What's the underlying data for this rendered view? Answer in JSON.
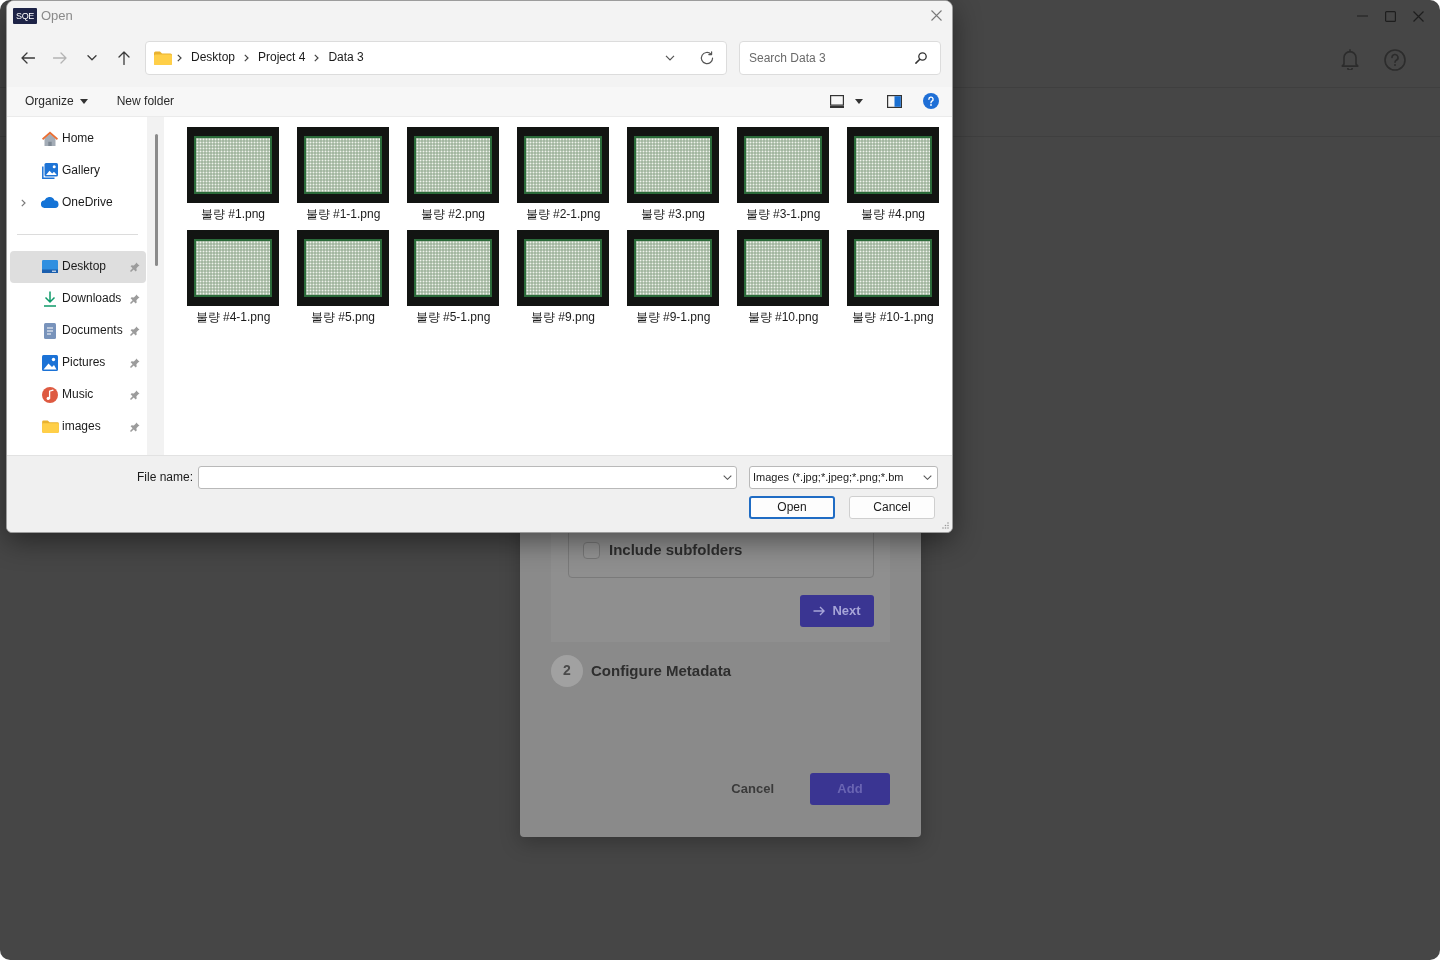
{
  "open_dialog": {
    "title": "Open",
    "app_icon_text": "SQE",
    "nav_buttons": [
      {
        "kind": "back",
        "disabled": false
      },
      {
        "kind": "forward",
        "disabled": true
      },
      {
        "kind": "recent",
        "disabled": false
      },
      {
        "kind": "up",
        "disabled": false
      }
    ],
    "breadcrumb": [
      "Desktop",
      "Project 4",
      "Data 3"
    ],
    "search": {
      "placeholder": "Search Data 3"
    },
    "toolbar": {
      "organize": "Organize",
      "new_folder": "New folder"
    },
    "sidebar": {
      "sections": [
        {
          "items": [
            {
              "label": "Home",
              "kind": "home",
              "selected": false,
              "expandable": false,
              "pinned": false
            },
            {
              "label": "Gallery",
              "kind": "gallery",
              "selected": false,
              "expandable": false,
              "pinned": false
            },
            {
              "label": "OneDrive",
              "kind": "cloud",
              "selected": false,
              "expandable": true,
              "pinned": false
            }
          ]
        },
        {
          "items": [
            {
              "label": "Desktop",
              "kind": "desktop",
              "selected": true,
              "expandable": false,
              "pinned": true
            },
            {
              "label": "Downloads",
              "kind": "downloads",
              "selected": false,
              "expandable": false,
              "pinned": true
            },
            {
              "label": "Documents",
              "kind": "documents",
              "selected": false,
              "expandable": false,
              "pinned": true
            },
            {
              "label": "Pictures",
              "kind": "pictures",
              "selected": false,
              "expandable": false,
              "pinned": true
            },
            {
              "label": "Music",
              "kind": "music",
              "selected": false,
              "expandable": false,
              "pinned": true
            },
            {
              "label": "images",
              "kind": "folder",
              "selected": false,
              "expandable": false,
              "pinned": true
            }
          ]
        }
      ]
    },
    "files": [
      {
        "name": "불량 #1.png",
        "selected": false
      },
      {
        "name": "불량 #1-1.png",
        "selected": false
      },
      {
        "name": "불량 #2.png",
        "selected": false
      },
      {
        "name": "불량 #2-1.png",
        "selected": false
      },
      {
        "name": "불량 #3.png",
        "selected": false
      },
      {
        "name": "불량 #3-1.png",
        "selected": false
      },
      {
        "name": "불량 #4.png",
        "selected": false
      },
      {
        "name": "불량 #4-1.png",
        "selected": false
      },
      {
        "name": "불량 #5.png",
        "selected": false
      },
      {
        "name": "불량 #5-1.png",
        "selected": false
      },
      {
        "name": "불량 #9.png",
        "selected": false
      },
      {
        "name": "불량 #9-1.png",
        "selected": false
      },
      {
        "name": "불량 #10.png",
        "selected": false
      },
      {
        "name": "불량 #10-1.png",
        "selected": false
      }
    ],
    "file_name": {
      "label": "File name:"
    },
    "file_type": {
      "value": "Images (*.jpg;*.jpeg;*.png;*.bm"
    },
    "buttons": [
      {
        "label": "Open",
        "focused": true
      },
      {
        "label": "Cancel",
        "focused": false
      }
    ]
  },
  "background_dialog": {
    "option": {
      "label": "Include subfolders",
      "checked": false
    },
    "next_button": {
      "label": "Next",
      "disabled": false
    },
    "steps": [
      {
        "number": "2",
        "title": "Configure Metadata",
        "active": false
      }
    ],
    "cancel_button": "Cancel",
    "add_button": {
      "label": "Add",
      "disabled": true
    }
  }
}
